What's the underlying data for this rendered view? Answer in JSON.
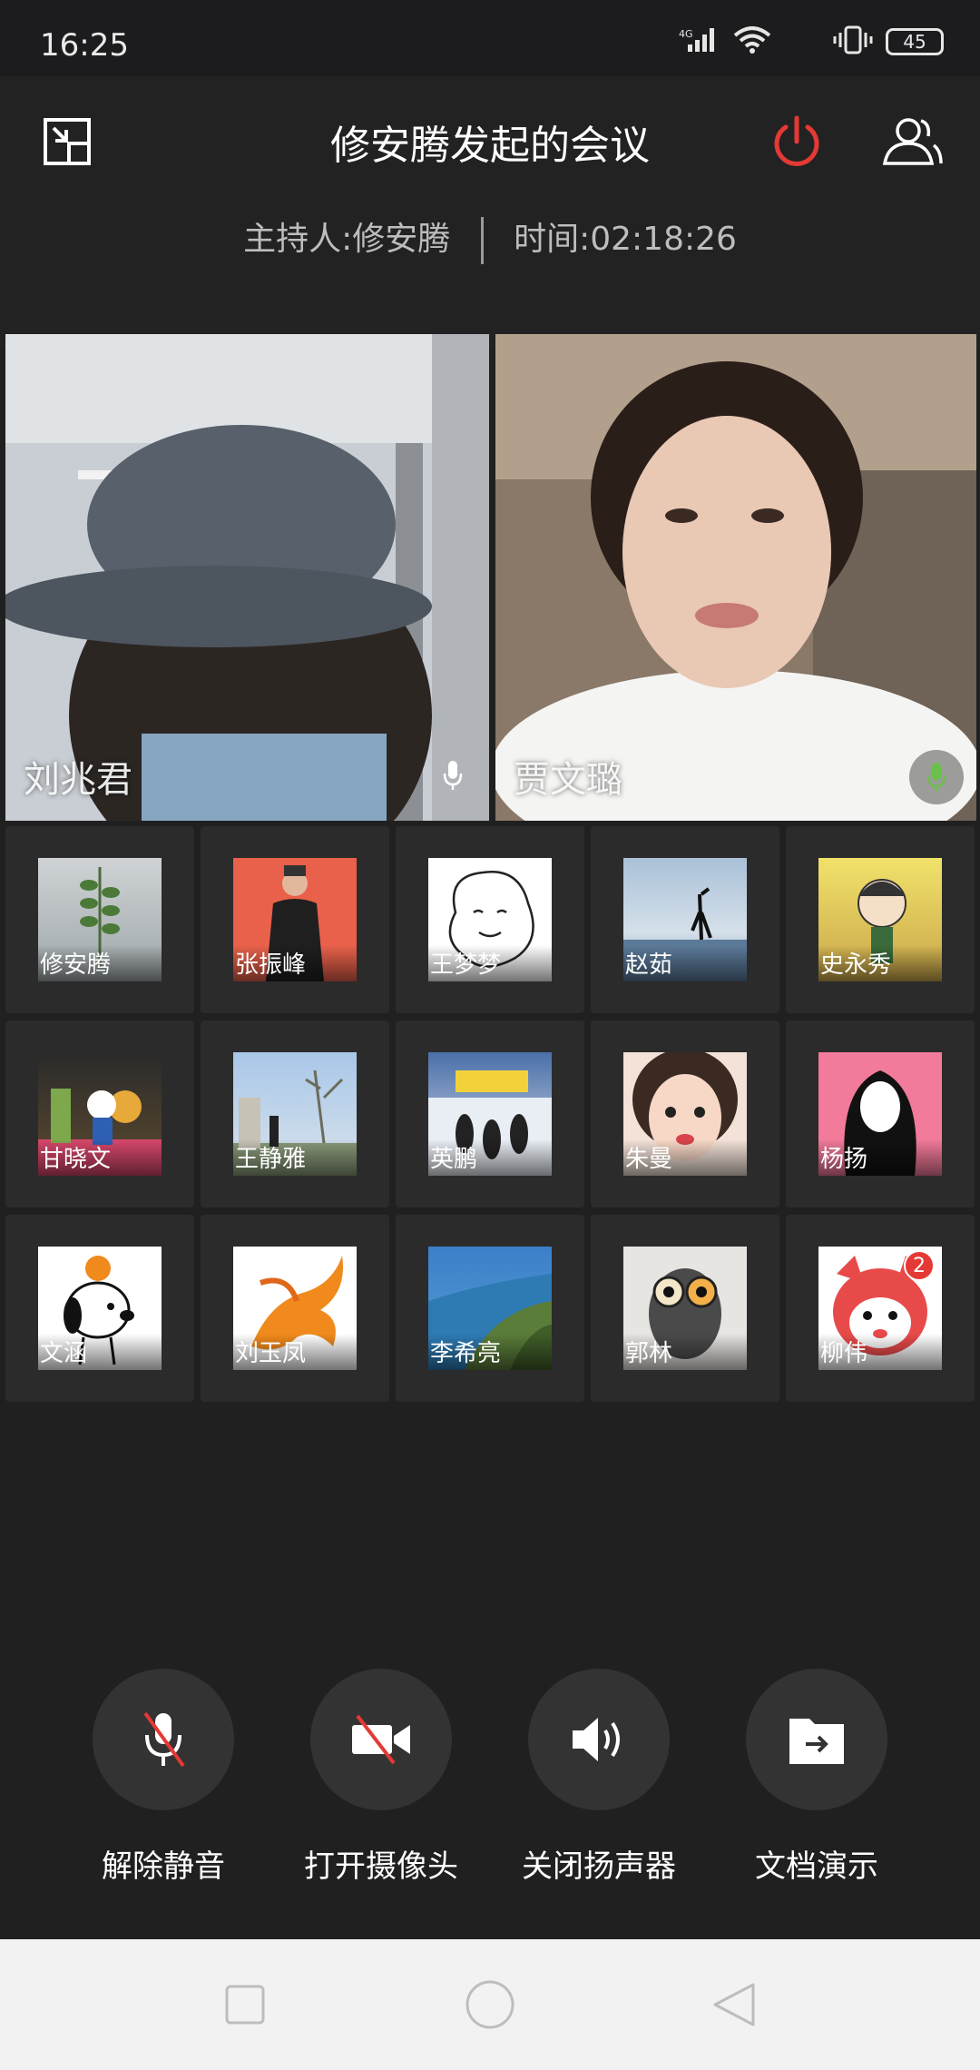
{
  "status_bar": {
    "time": "16:25",
    "network": "4G",
    "battery": "45"
  },
  "header": {
    "title": "修安腾发起的会议",
    "host_label": "主持人:修安腾",
    "time_label": "时间:02:18:26"
  },
  "videos": [
    {
      "name": "刘兆君",
      "mic": "unmuted"
    },
    {
      "name": "贾文璐",
      "mic": "speaking"
    }
  ],
  "participants": [
    {
      "name": "修安腾"
    },
    {
      "name": "张振峰"
    },
    {
      "name": "王梦梦"
    },
    {
      "name": "赵茹"
    },
    {
      "name": "史永秀"
    },
    {
      "name": "甘晓文"
    },
    {
      "name": "王静雅"
    },
    {
      "name": "英鹏"
    },
    {
      "name": "朱曼"
    },
    {
      "name": "杨扬"
    },
    {
      "name": "文涵"
    },
    {
      "name": "刘玉凤"
    },
    {
      "name": "李希亮"
    },
    {
      "name": "郭林"
    },
    {
      "name": "柳伟",
      "badge": "2"
    }
  ],
  "controls": {
    "unmute": "解除静音",
    "camera_on": "打开摄像头",
    "speaker_off": "关闭扬声器",
    "doc_present": "文档演示"
  },
  "colors": {
    "power_red": "#e53935",
    "background": "#202020"
  }
}
